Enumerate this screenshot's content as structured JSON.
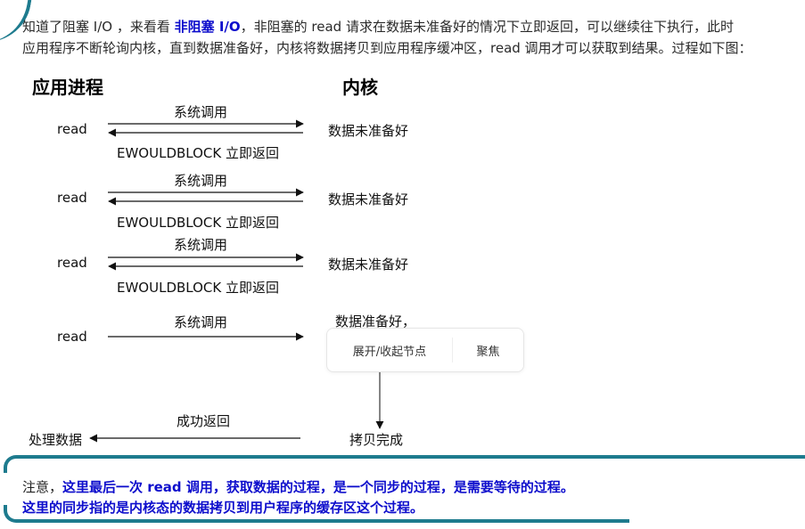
{
  "intro": {
    "segments": [
      {
        "text": "知道了阻塞 I/O ，来看看 ",
        "style": "plain"
      },
      {
        "text": "非阻塞 I/O",
        "style": "highlight"
      },
      {
        "text": "，非阻塞的 read 请求在数据未准备好的情况下立即返回，可以继续往下执行，此时",
        "style": "plain"
      }
    ],
    "line2": "应用程序不断轮询内核，直到数据准备好，内核将数据拷贝到应用程序缓冲区，read 调用才可以获取到结果。过程如下图："
  },
  "diagram": {
    "left_header": "应用进程",
    "right_header": "内核",
    "rounds": [
      {
        "left": "read",
        "call_label": "系统调用",
        "right": "数据未准备好",
        "return_label": "EWOULDBLOCK 立即返回"
      },
      {
        "left": "read",
        "call_label": "系统调用",
        "right": "数据未准备好",
        "return_label": "EWOULDBLOCK 立即返回"
      },
      {
        "left": "read",
        "call_label": "系统调用",
        "right": "数据未准备好",
        "return_label": "EWOULDBLOCK 立即返回"
      }
    ],
    "final": {
      "left": "read",
      "call_label": "系统调用",
      "right_ready": "数据准备好，",
      "right_done": "拷贝完成",
      "return_label": "成功返回",
      "left_result": "处理数据"
    }
  },
  "context_menu": {
    "items": [
      {
        "label": "展开/收起节点"
      },
      {
        "label": "聚焦"
      }
    ]
  },
  "note": {
    "prefix": "注意，",
    "line1": "这里最后一次 read 调用，获取数据的过程，是一个同步的过程，是需要等待的过程。",
    "line2": "这里的同步指的是内核态的数据拷贝到用户程序的缓存区这个过程。"
  },
  "colors": {
    "accent_border": "#1e7b8e",
    "highlight_text": "#0d0dcc"
  }
}
